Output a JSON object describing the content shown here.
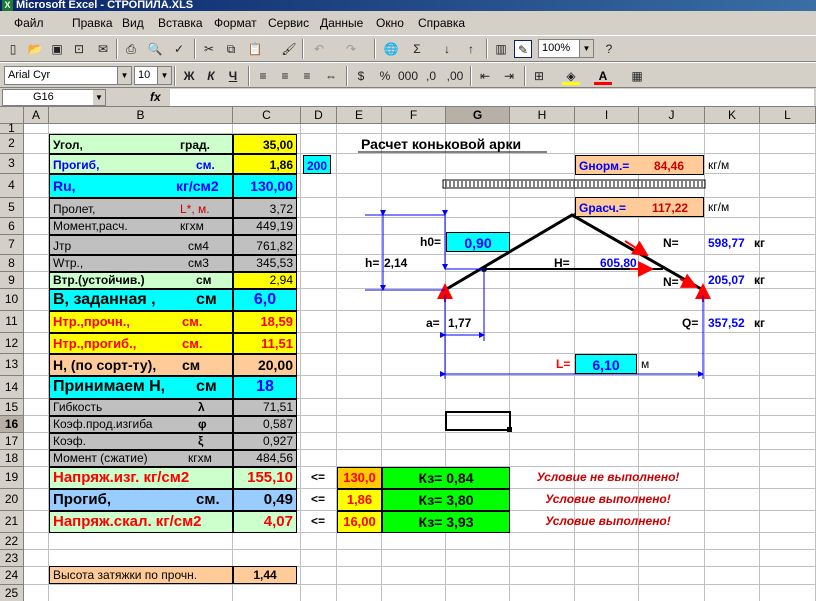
{
  "window": {
    "title": "Microsoft Excel - СТРОПИЛА.XLS"
  },
  "menu": [
    "Файл",
    "Правка",
    "Вид",
    "Вставка",
    "Формат",
    "Сервис",
    "Данные",
    "Окно",
    "Справка"
  ],
  "toolbar": {
    "zoom": "100%",
    "font": "Arial Cyr",
    "size": "10",
    "bold": "Ж",
    "italic": "К",
    "underline": "Ч"
  },
  "formula_bar": {
    "cell_ref": "G16",
    "fx": "fx",
    "value": ""
  },
  "columns": [
    "A",
    "B",
    "C",
    "D",
    "E",
    "F",
    "G",
    "H",
    "I",
    "J",
    "K",
    "L"
  ],
  "rows": [
    "1",
    "2",
    "3",
    "4",
    "5",
    "6",
    "7",
    "8",
    "9",
    "10",
    "11",
    "12",
    "13",
    "14",
    "15",
    "16",
    "17",
    "18",
    "19",
    "20",
    "21",
    "22",
    "23",
    "24",
    "25"
  ],
  "cells": {
    "b2a": "Угол,",
    "b2b": "град.",
    "c2": "35,00",
    "b3a": "Прогиб,",
    "b3b": "см.",
    "c3": "1,86",
    "d3": "200",
    "b4a": "Ru,",
    "b4b": "кг/см2",
    "c4": "130,00",
    "b5a": "Пролет,",
    "b5b": "L*, м.",
    "c5": "3,72",
    "b6a": "Момент,расч.",
    "b6b": "кгхм",
    "c6": "449,19",
    "b7a": "Jтр",
    "b7b": "см4",
    "c7": "761,82",
    "b8a": "Wтр.,",
    "b8b": "см3",
    "c8": "345,53",
    "b9a": "Втр.(устойчив.)",
    "b9b": "см",
    "c9": "2,94",
    "b10a": "В, заданная ,",
    "b10b": "см",
    "c10": "6,0",
    "b11a": "Нтр.,прочн.,",
    "b11b": "см.",
    "c11": "18,59",
    "b12a": "Нтр.,прогиб.,",
    "b12b": "см.",
    "c12": "11,51",
    "b13a": "Н, (по сорт-ту),",
    "b13b": "см",
    "c13": "20,00",
    "b14a": "Принимаем Н,",
    "b14b": "см",
    "c14": "18",
    "b15a": "Гибкость",
    "b15b": "λ",
    "c15": "71,51",
    "b16a": "Коэф.прод.изгиба",
    "b16b": "φ",
    "c16": "0,587",
    "b17a": "Коэф.",
    "b17b": "ξ",
    "c17": "0,927",
    "b18a": "Момент (сжатие)",
    "b18b": "кгхм",
    "c18": "484,56",
    "b19": "Напряж.изг.  кг/см2",
    "c19": "155,10",
    "d19": "<=",
    "e19": "130,0",
    "f19": "Кз=  0,84",
    "h19": "Условие не выполнено!",
    "b20a": "Прогиб,",
    "b20b": "см.",
    "c20": "0,49",
    "d20": "<=",
    "e20": "1,86",
    "f20": "Кз=  3,80",
    "h20": "Условие выполнено!",
    "b21": "Напряж.скал. кг/см2",
    "c21": "4,07",
    "d21": "<=",
    "e21": "16,00",
    "f21": "Кз=  3,93",
    "h21": "Условие выполнено!",
    "b24": "Высота затяжки по прочн.",
    "c24": "1,44"
  },
  "diagram": {
    "title": "Расчет коньковой арки",
    "g_norm_label": "Gнорм.=",
    "g_norm": "84,46",
    "g_unit1": "кг/м",
    "g_calc_label": "Gрасч.=",
    "g_calc": "117,22",
    "g_unit2": "кг/м",
    "h0_label": "h0=",
    "h0": "0,90",
    "h_label": "h=",
    "h": "2,14",
    "H_label": "H=",
    "H": "605,80",
    "N1_label": "N=",
    "N1": "598,77",
    "N1_unit": "кг",
    "N2_label": "N=",
    "N2": "205,07",
    "N2_unit": "кг",
    "a_label": "a=",
    "a": "1,77",
    "Q_label": "Q=",
    "Q": "357,52",
    "Q_unit": "кг",
    "L_label": "L=",
    "L": "6,10",
    "L_unit": "м"
  },
  "colors": {
    "yellow": "#ffff00",
    "cyan": "#00ffff",
    "gray": "#c0c0c0",
    "green": "#00ff00",
    "peach": "#ffcc99",
    "lightgreen": "#ccffcc",
    "lightblue": "#99ccff",
    "red": "#ff0000",
    "blue": "#0000ff",
    "darkred": "#cc0000"
  }
}
